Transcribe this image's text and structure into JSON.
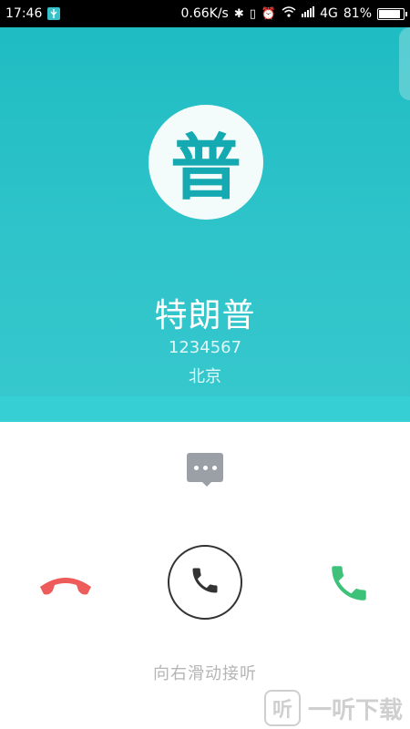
{
  "status_bar": {
    "time": "17:46",
    "net_speed": "0.66K/s",
    "network": "4G",
    "battery": "81%",
    "battery_level": 0.81,
    "icons": [
      "usb-icon",
      "bluetooth-icon",
      "vibrate-icon",
      "alarm-icon",
      "wifi-icon",
      "signal-icon",
      "battery-icon"
    ]
  },
  "caller": {
    "avatar_char": "普",
    "name": "特朗普",
    "number": "1234567",
    "location": "北京"
  },
  "actions": {
    "message_icon": "message-icon",
    "reject_icon": "phone-hangup-icon",
    "answer_icon": "phone-answer-icon",
    "slider_icon": "phone-icon",
    "hint": "向右滑动接听"
  },
  "watermark": {
    "logo_char": "听",
    "text": "一听下载"
  },
  "colors": {
    "teal": "#2fc4ca",
    "reject": "#ee5b5b",
    "answer": "#3ec27a"
  }
}
